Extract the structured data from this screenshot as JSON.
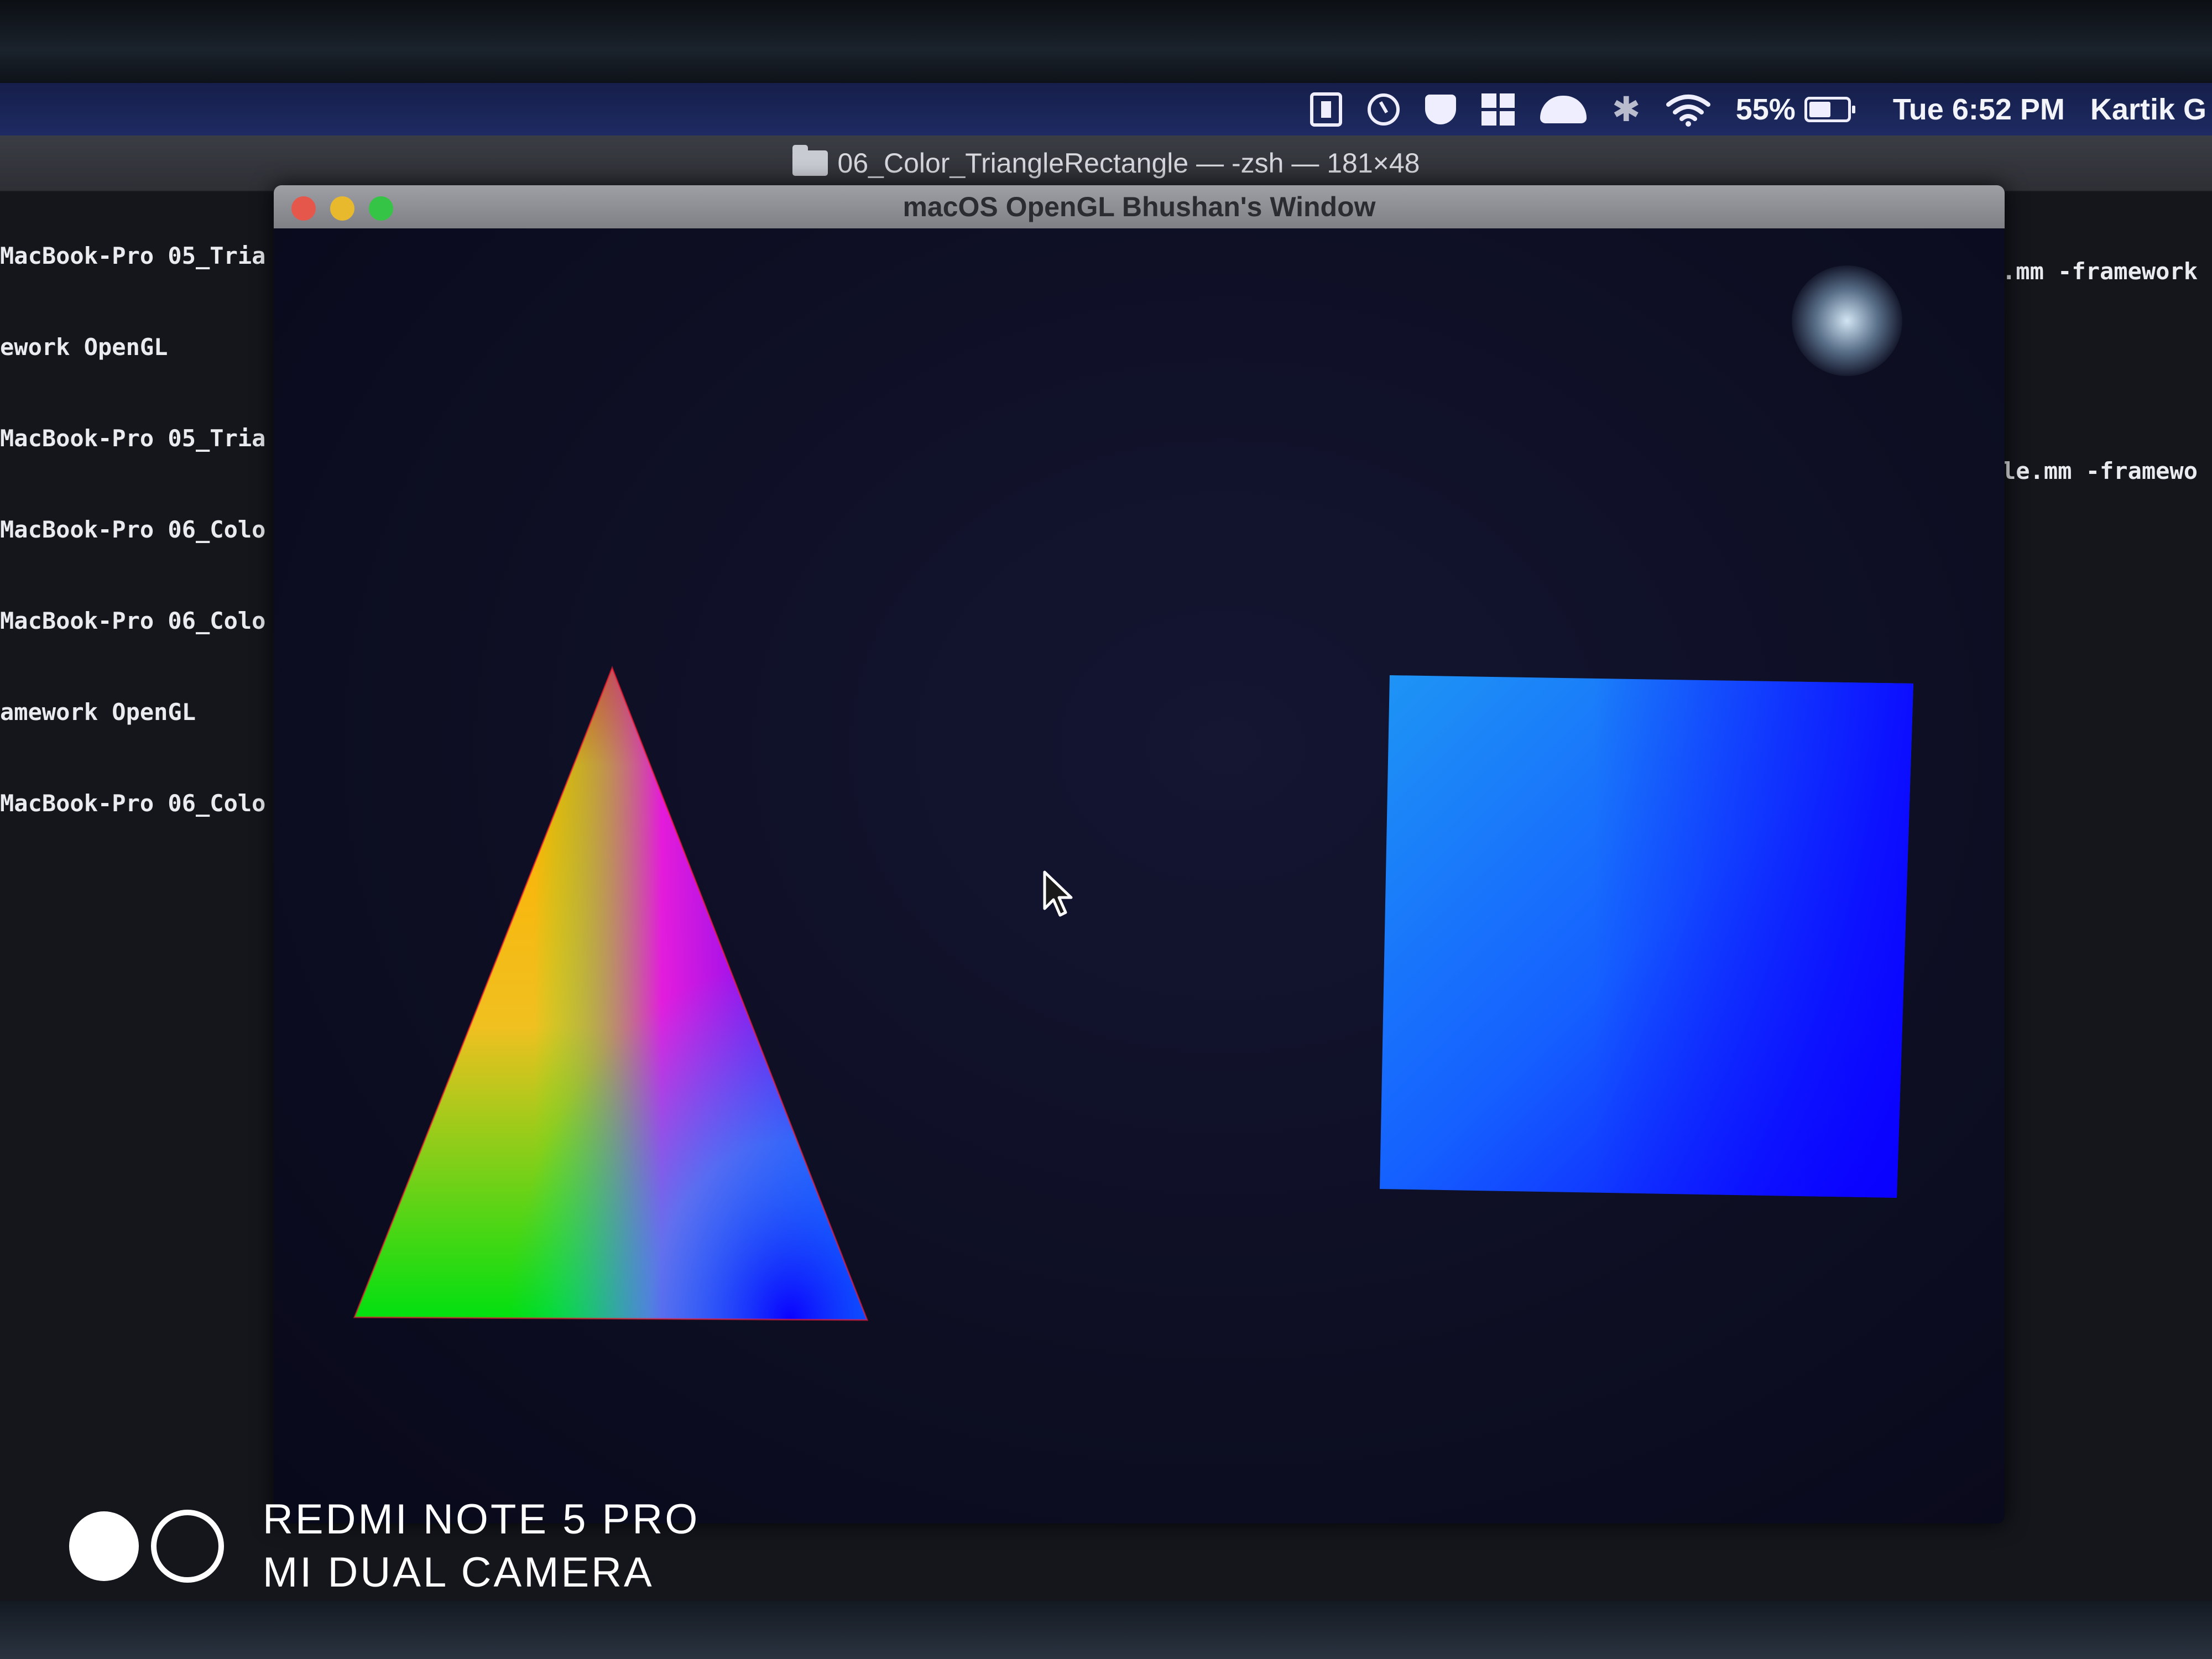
{
  "menubar": {
    "battery_percent": "55%",
    "clock": "Tue 6:52 PM",
    "user": "Kartik G",
    "icons": [
      "box-icon",
      "timer-icon",
      "shield-icon",
      "grid-icon",
      "bell-icon",
      "bluetooth-icon",
      "wifi-icon",
      "battery-icon"
    ]
  },
  "terminal": {
    "title": "06_Color_TriangleRectangle — -zsh — 181×48",
    "left_lines": [
      "MacBook-Pro 05_Tria",
      "ework OpenGL",
      "MacBook-Pro 05_Tria",
      "MacBook-Pro 06_Colo",
      "MacBook-Pro 06_Colo",
      "amework OpenGL",
      "MacBook-Pro 06_Colo"
    ],
    "right_lines": [
      ".mm -framework",
      "le.mm -framewo"
    ]
  },
  "gl_window": {
    "title": "macOS OpenGL Bhushan's Window",
    "triangle_colors": {
      "top": "#ff2a00",
      "left": "#00ff00",
      "right": "#0000ff"
    },
    "square_colors": {
      "top_left": "#1e90ff",
      "others": "#0a00ff"
    }
  },
  "watermark": {
    "line1": "REDMI NOTE 5 PRO",
    "line2": "MI DUAL CAMERA"
  }
}
